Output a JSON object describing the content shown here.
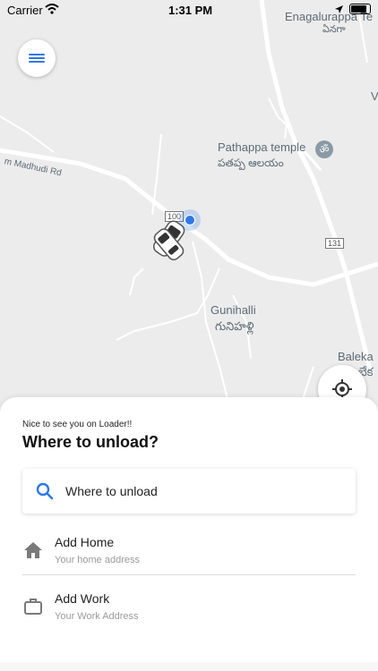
{
  "status_bar": {
    "carrier": "Carrier",
    "time": "1:31 PM"
  },
  "map": {
    "labels": {
      "top_place": "Enagalurappa Te",
      "top_place_local": "ఏనగా",
      "temple": "Pathappa temple",
      "temple_local": "పతప్ప ఆలయం",
      "road_left": "m Madhudi Rd",
      "village": "Gunihalli",
      "village_local": "గునిహళ్లి",
      "right_place": "Baleka",
      "right_place_local": "బేక",
      "route_100": "100",
      "route_131": "131",
      "v_letter": "V"
    }
  },
  "sheet": {
    "greeting": "Nice to see you on Loader!!",
    "title": "Where to unload?",
    "search_label": "Where to unload",
    "home": {
      "title": "Add Home",
      "subtitle": "Your home address"
    },
    "work": {
      "title": "Add Work",
      "subtitle": "Your Work Address"
    }
  },
  "colors": {
    "accent": "#2f78e6",
    "map_bg": "#ececec",
    "road": "#ffffff"
  }
}
